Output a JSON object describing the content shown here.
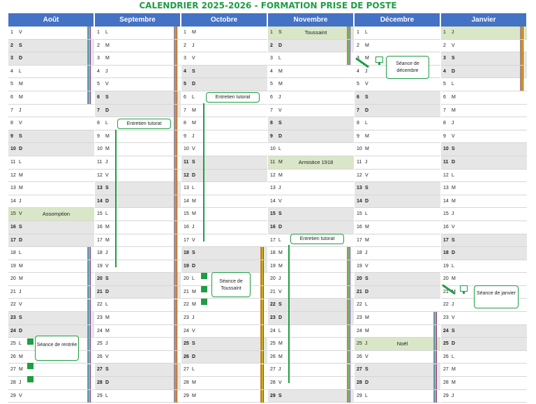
{
  "title": "CALENDRIER 2025-2026 - FORMATION PRISE DE POSTE",
  "colors": {
    "header": "#4472c4",
    "accent": "#1e9d44",
    "weekend": "#e6e6e6",
    "holiday": "#d9e6c8"
  },
  "months": [
    {
      "name": "Août",
      "days": [
        {
          "n": "1",
          "d": "V"
        },
        {
          "n": "2",
          "d": "S",
          "w": true
        },
        {
          "n": "3",
          "d": "D",
          "w": true
        },
        {
          "n": "4",
          "d": "L"
        },
        {
          "n": "5",
          "d": "M"
        },
        {
          "n": "6",
          "d": "M"
        },
        {
          "n": "7",
          "d": "J"
        },
        {
          "n": "8",
          "d": "V"
        },
        {
          "n": "9",
          "d": "S",
          "w": true
        },
        {
          "n": "10",
          "d": "D",
          "w": true
        },
        {
          "n": "11",
          "d": "L"
        },
        {
          "n": "12",
          "d": "M"
        },
        {
          "n": "13",
          "d": "M"
        },
        {
          "n": "14",
          "d": "J"
        },
        {
          "n": "15",
          "d": "V",
          "h": true,
          "event": "Assomption"
        },
        {
          "n": "16",
          "d": "S",
          "w": true
        },
        {
          "n": "17",
          "d": "D",
          "w": true
        },
        {
          "n": "18",
          "d": "L"
        },
        {
          "n": "19",
          "d": "M"
        },
        {
          "n": "20",
          "d": "M"
        },
        {
          "n": "21",
          "d": "J"
        },
        {
          "n": "22",
          "d": "V"
        },
        {
          "n": "23",
          "d": "S",
          "w": true
        },
        {
          "n": "24",
          "d": "D",
          "w": true
        },
        {
          "n": "25",
          "d": "L"
        },
        {
          "n": "26",
          "d": "M"
        },
        {
          "n": "27",
          "d": "M"
        },
        {
          "n": "28",
          "d": "J"
        },
        {
          "n": "29",
          "d": "V"
        }
      ]
    },
    {
      "name": "Septembre",
      "days": [
        {
          "n": "1",
          "d": "L"
        },
        {
          "n": "2",
          "d": "M"
        },
        {
          "n": "3",
          "d": "M"
        },
        {
          "n": "4",
          "d": "J"
        },
        {
          "n": "5",
          "d": "V"
        },
        {
          "n": "6",
          "d": "S",
          "w": true
        },
        {
          "n": "7",
          "d": "D",
          "w": true
        },
        {
          "n": "8",
          "d": "L"
        },
        {
          "n": "9",
          "d": "M"
        },
        {
          "n": "10",
          "d": "M"
        },
        {
          "n": "11",
          "d": "J"
        },
        {
          "n": "12",
          "d": "V"
        },
        {
          "n": "13",
          "d": "S",
          "w": true
        },
        {
          "n": "14",
          "d": "D",
          "w": true
        },
        {
          "n": "15",
          "d": "L"
        },
        {
          "n": "16",
          "d": "M"
        },
        {
          "n": "17",
          "d": "M"
        },
        {
          "n": "18",
          "d": "J"
        },
        {
          "n": "19",
          "d": "V"
        },
        {
          "n": "20",
          "d": "S",
          "w": true
        },
        {
          "n": "21",
          "d": "D",
          "w": true
        },
        {
          "n": "22",
          "d": "L"
        },
        {
          "n": "23",
          "d": "M"
        },
        {
          "n": "24",
          "d": "M"
        },
        {
          "n": "25",
          "d": "J"
        },
        {
          "n": "26",
          "d": "V"
        },
        {
          "n": "27",
          "d": "S",
          "w": true
        },
        {
          "n": "28",
          "d": "D",
          "w": true
        },
        {
          "n": "29",
          "d": "L"
        }
      ]
    },
    {
      "name": "Octobre",
      "days": [
        {
          "n": "1",
          "d": "M"
        },
        {
          "n": "2",
          "d": "J"
        },
        {
          "n": "3",
          "d": "V"
        },
        {
          "n": "4",
          "d": "S",
          "w": true
        },
        {
          "n": "5",
          "d": "D",
          "w": true
        },
        {
          "n": "6",
          "d": "L"
        },
        {
          "n": "7",
          "d": "M"
        },
        {
          "n": "8",
          "d": "M"
        },
        {
          "n": "9",
          "d": "J"
        },
        {
          "n": "10",
          "d": "V"
        },
        {
          "n": "11",
          "d": "S",
          "w": true
        },
        {
          "n": "12",
          "d": "D",
          "w": true
        },
        {
          "n": "13",
          "d": "L"
        },
        {
          "n": "14",
          "d": "M"
        },
        {
          "n": "15",
          "d": "M"
        },
        {
          "n": "16",
          "d": "J"
        },
        {
          "n": "17",
          "d": "V"
        },
        {
          "n": "18",
          "d": "S",
          "w": true
        },
        {
          "n": "19",
          "d": "D",
          "w": true
        },
        {
          "n": "20",
          "d": "L"
        },
        {
          "n": "21",
          "d": "M"
        },
        {
          "n": "22",
          "d": "M"
        },
        {
          "n": "23",
          "d": "J"
        },
        {
          "n": "24",
          "d": "V"
        },
        {
          "n": "25",
          "d": "S",
          "w": true
        },
        {
          "n": "26",
          "d": "D",
          "w": true
        },
        {
          "n": "27",
          "d": "L"
        },
        {
          "n": "28",
          "d": "M"
        },
        {
          "n": "29",
          "d": "M"
        }
      ]
    },
    {
      "name": "Novembre",
      "days": [
        {
          "n": "1",
          "d": "S",
          "h": true,
          "event": "Toussaint"
        },
        {
          "n": "2",
          "d": "D",
          "w": true
        },
        {
          "n": "3",
          "d": "L"
        },
        {
          "n": "4",
          "d": "M"
        },
        {
          "n": "5",
          "d": "M"
        },
        {
          "n": "6",
          "d": "J"
        },
        {
          "n": "7",
          "d": "V"
        },
        {
          "n": "8",
          "d": "S",
          "w": true
        },
        {
          "n": "9",
          "d": "D",
          "w": true
        },
        {
          "n": "10",
          "d": "L"
        },
        {
          "n": "11",
          "d": "M",
          "h": true,
          "event": "Armistice 1918"
        },
        {
          "n": "12",
          "d": "M"
        },
        {
          "n": "13",
          "d": "J"
        },
        {
          "n": "14",
          "d": "V"
        },
        {
          "n": "15",
          "d": "S",
          "w": true
        },
        {
          "n": "16",
          "d": "D",
          "w": true
        },
        {
          "n": "17",
          "d": "L"
        },
        {
          "n": "18",
          "d": "M"
        },
        {
          "n": "19",
          "d": "M"
        },
        {
          "n": "20",
          "d": "J"
        },
        {
          "n": "21",
          "d": "V"
        },
        {
          "n": "22",
          "d": "S",
          "w": true
        },
        {
          "n": "23",
          "d": "D",
          "w": true
        },
        {
          "n": "24",
          "d": "L"
        },
        {
          "n": "25",
          "d": "M"
        },
        {
          "n": "26",
          "d": "M"
        },
        {
          "n": "27",
          "d": "J"
        },
        {
          "n": "28",
          "d": "V"
        },
        {
          "n": "29",
          "d": "S",
          "w": true
        }
      ]
    },
    {
      "name": "Décembre",
      "days": [
        {
          "n": "1",
          "d": "L"
        },
        {
          "n": "2",
          "d": "M"
        },
        {
          "n": "3",
          "d": "M"
        },
        {
          "n": "4",
          "d": "J"
        },
        {
          "n": "5",
          "d": "V"
        },
        {
          "n": "6",
          "d": "S",
          "w": true
        },
        {
          "n": "7",
          "d": "D",
          "w": true
        },
        {
          "n": "8",
          "d": "L"
        },
        {
          "n": "9",
          "d": "M"
        },
        {
          "n": "10",
          "d": "M"
        },
        {
          "n": "11",
          "d": "J"
        },
        {
          "n": "12",
          "d": "V"
        },
        {
          "n": "13",
          "d": "S",
          "w": true
        },
        {
          "n": "14",
          "d": "D",
          "w": true
        },
        {
          "n": "15",
          "d": "L"
        },
        {
          "n": "16",
          "d": "M"
        },
        {
          "n": "17",
          "d": "M"
        },
        {
          "n": "18",
          "d": "J"
        },
        {
          "n": "19",
          "d": "V"
        },
        {
          "n": "20",
          "d": "S",
          "w": true
        },
        {
          "n": "21",
          "d": "D",
          "w": true
        },
        {
          "n": "22",
          "d": "L"
        },
        {
          "n": "23",
          "d": "M"
        },
        {
          "n": "24",
          "d": "M"
        },
        {
          "n": "25",
          "d": "J",
          "h": true,
          "event": "Noël"
        },
        {
          "n": "26",
          "d": "V"
        },
        {
          "n": "27",
          "d": "S",
          "w": true
        },
        {
          "n": "28",
          "d": "D",
          "w": true
        },
        {
          "n": "29",
          "d": "L"
        }
      ]
    },
    {
      "name": "Janvier",
      "days": [
        {
          "n": "1",
          "d": "J",
          "h": true
        },
        {
          "n": "2",
          "d": "V"
        },
        {
          "n": "3",
          "d": "S",
          "w": true
        },
        {
          "n": "4",
          "d": "D",
          "w": true
        },
        {
          "n": "5",
          "d": "L"
        },
        {
          "n": "6",
          "d": "M"
        },
        {
          "n": "7",
          "d": "M"
        },
        {
          "n": "8",
          "d": "J"
        },
        {
          "n": "9",
          "d": "V"
        },
        {
          "n": "10",
          "d": "S",
          "w": true
        },
        {
          "n": "11",
          "d": "D",
          "w": true
        },
        {
          "n": "12",
          "d": "L"
        },
        {
          "n": "13",
          "d": "M"
        },
        {
          "n": "14",
          "d": "M"
        },
        {
          "n": "15",
          "d": "J"
        },
        {
          "n": "16",
          "d": "V"
        },
        {
          "n": "17",
          "d": "S",
          "w": true
        },
        {
          "n": "18",
          "d": "D",
          "w": true
        },
        {
          "n": "19",
          "d": "L"
        },
        {
          "n": "20",
          "d": "M"
        },
        {
          "n": "21",
          "d": "M"
        },
        {
          "n": "22",
          "d": "J"
        },
        {
          "n": "23",
          "d": "V"
        },
        {
          "n": "24",
          "d": "S",
          "w": true
        },
        {
          "n": "25",
          "d": "D",
          "w": true
        },
        {
          "n": "26",
          "d": "L"
        },
        {
          "n": "27",
          "d": "M"
        },
        {
          "n": "28",
          "d": "M"
        },
        {
          "n": "29",
          "d": "J"
        }
      ]
    }
  ],
  "callouts": {
    "rentree": "Séance de rentrée",
    "toussaint": "Séance de Toussaint",
    "decembre": "Séance de décembre",
    "janvier": "Séance de janvier",
    "tutorat_sept": "Entretien tutorat",
    "tutorat_oct": "Entretien tutorat",
    "tutorat_nov": "Entretien tutorat"
  },
  "icons": [
    "monitor-icon",
    "square-marker-icon"
  ]
}
